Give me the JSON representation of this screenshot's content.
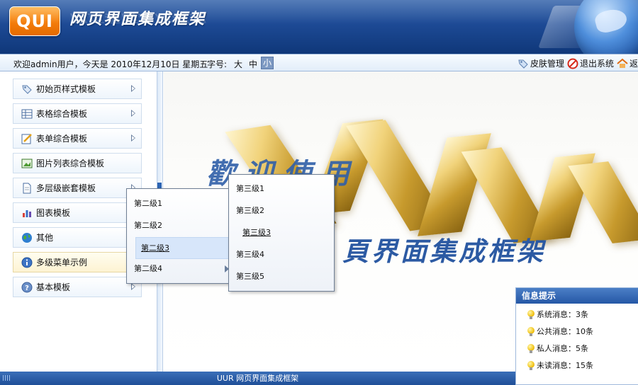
{
  "header": {
    "logo": "QUI",
    "title": "网页界面集成框架"
  },
  "infobar": {
    "welcome": "欢迎admin用户，今天是 2010年12月10日 星期五",
    "font_size_label": "字号:",
    "font_sizes": [
      "大",
      "中",
      "小"
    ],
    "font_size_selected": "小",
    "links": [
      {
        "label": "皮肤管理",
        "icon": "tag-icon"
      },
      {
        "label": "退出系统",
        "icon": "exit-icon"
      },
      {
        "label": "返",
        "icon": "home-icon"
      }
    ]
  },
  "sidebar": {
    "items": [
      {
        "label": "初始页样式模板",
        "icon": "tag-icon",
        "has_submenu": true
      },
      {
        "label": "表格综合模板",
        "icon": "table-icon",
        "has_submenu": true
      },
      {
        "label": "表单综合模板",
        "icon": "form-edit-icon",
        "has_submenu": true
      },
      {
        "label": "图片列表综合模板",
        "icon": "image-list-icon",
        "has_submenu": false
      },
      {
        "label": "多层级嵌套模板",
        "icon": "document-icon",
        "has_submenu": true
      },
      {
        "label": "图表模板",
        "icon": "chart-icon",
        "has_submenu": true
      },
      {
        "label": "其他",
        "icon": "globe-icon",
        "has_submenu": false
      },
      {
        "label": "多级菜单示例",
        "icon": "info-icon",
        "has_submenu": false,
        "active": true
      },
      {
        "label": "基本模板",
        "icon": "help-icon",
        "has_submenu": true
      }
    ]
  },
  "main": {
    "welcome_text": "歡迎使用",
    "subtitle_text": "頁界面集成框架"
  },
  "submenu_level2": {
    "items": [
      {
        "label": "第二级1"
      },
      {
        "label": "第二级2"
      },
      {
        "label": "第二级3",
        "highlighted": true
      },
      {
        "label": "第二级4",
        "has_submenu": true
      }
    ]
  },
  "submenu_level3": {
    "items": [
      {
        "label": "第三级1"
      },
      {
        "label": "第三级2"
      },
      {
        "label": "第三级3",
        "highlighted": true
      },
      {
        "label": "第三级4"
      },
      {
        "label": "第三级5"
      }
    ]
  },
  "info_panel": {
    "title": "信息提示",
    "rows": [
      {
        "label": "系统消息：3条"
      },
      {
        "label": "公共消息：10条"
      },
      {
        "label": "私人消息：5条"
      },
      {
        "label": "未读消息：15条"
      }
    ]
  },
  "status_bar": {
    "text": "UUR 网页界面集成框架"
  },
  "colors": {
    "header_blue": "#1d4a95",
    "logo_orange": "#f47d0b",
    "accent_blue": "#2c5aa3",
    "active_item_bg": "#fdf3d2"
  }
}
